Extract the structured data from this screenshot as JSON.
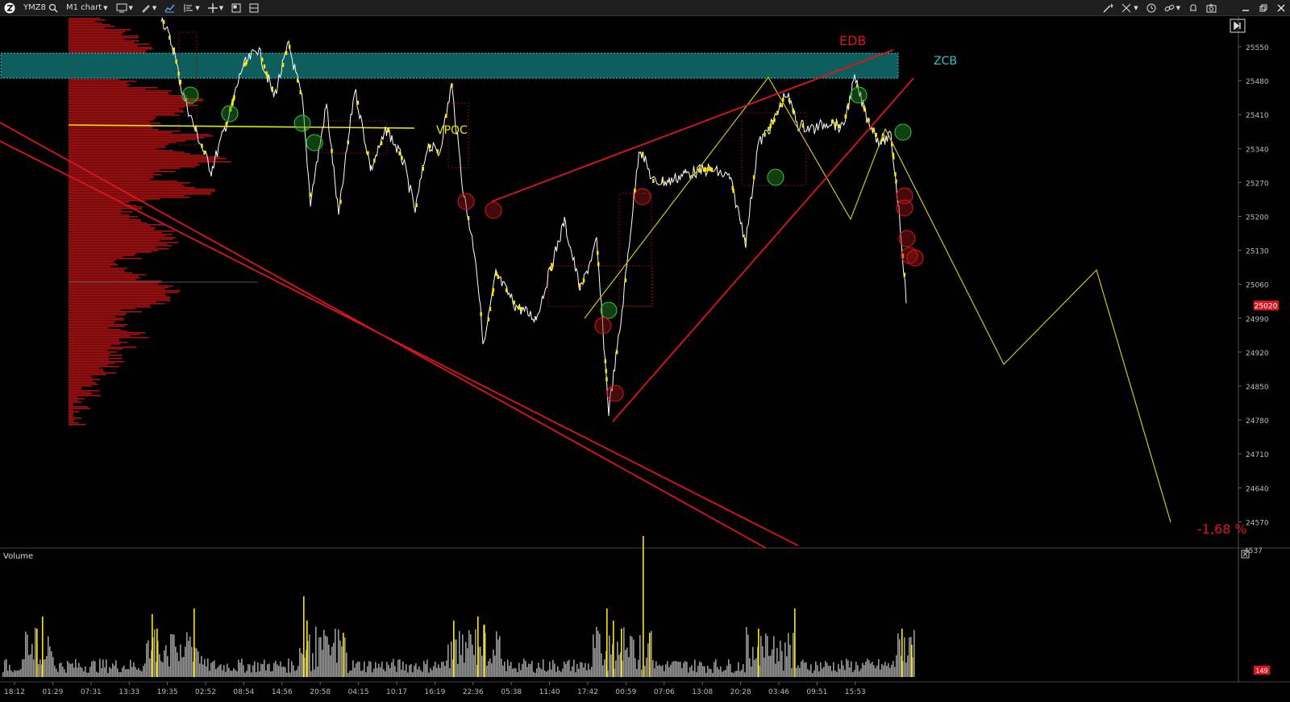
{
  "toolbar": {
    "symbol": "YMZ8",
    "chart_type": "M1 chart",
    "icons": [
      "app-logo-icon",
      "search-icon",
      "chart-settings-icon",
      "pencil-icon",
      "line-chart-icon",
      "indicators-icon",
      "crosshair-icon",
      "layout-icon",
      "wand-icon",
      "arrows-icon",
      "link-icon",
      "camera-icon"
    ],
    "window_controls": [
      "minimize-icon",
      "maximize-icon",
      "close-icon"
    ]
  },
  "price_axis": {
    "labels": [
      "25550",
      "25480",
      "25410",
      "25340",
      "25270",
      "25200",
      "25130",
      "25060",
      "24990",
      "24920",
      "24850",
      "24780",
      "24710",
      "24640",
      "24570"
    ],
    "current_price": "25020",
    "current_price_color": "#e0141e"
  },
  "time_axis": {
    "labels": [
      "18:12",
      "01:29",
      "07:31",
      "13:33",
      "19:35",
      "02:52",
      "08:54",
      "14:56",
      "20:58",
      "04:15",
      "10:17",
      "16:19",
      "22:36",
      "05:38",
      "11:40",
      "17:42",
      "00:59",
      "07:06",
      "13:08",
      "20:28",
      "03:46",
      "09:51",
      "15:53"
    ]
  },
  "annotations": {
    "edb": "EDB",
    "zcb": "ZCB",
    "vpoc": "VPOC",
    "percent": "-1,68 %"
  },
  "volume_panel": {
    "title": "Volume",
    "max_label": "4537",
    "current_label": "149"
  },
  "colors": {
    "profile": "#a50f12",
    "trendline": "#e0141e",
    "zone": "#0e5e5e",
    "forecast": "#c8c81e",
    "candle": "#ffffff",
    "highlight": "#ffe600",
    "volume": "#9a9a9a"
  }
}
